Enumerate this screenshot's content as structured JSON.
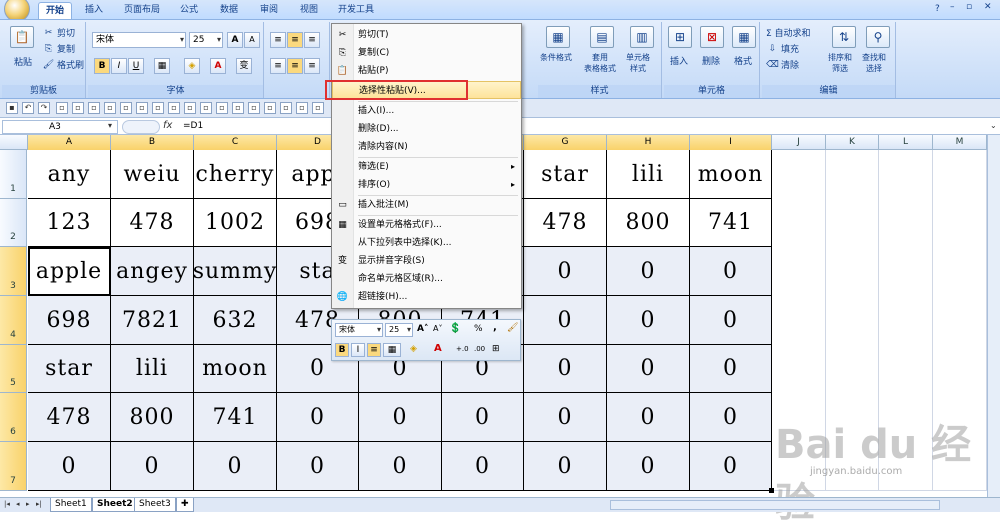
{
  "tabs": [
    "开始",
    "插入",
    "页面布局",
    "公式",
    "数据",
    "审阅",
    "视图",
    "开发工具"
  ],
  "ribbon": {
    "clipboard": {
      "paste": "粘贴",
      "cut": "剪切",
      "copy": "复制",
      "format_painter": "格式刷",
      "label": "剪贴板"
    },
    "font": {
      "name": "宋体",
      "size": "25",
      "label": "字体",
      "bold": "B",
      "italic": "I",
      "underline": "U",
      "grow": "A",
      "shrink": "A",
      "phonetic": "变"
    },
    "styles": {
      "conditional": "条件格式",
      "table": "套用\n表格格式",
      "cell": "单元格\n样式",
      "label": "样式"
    },
    "cells": {
      "insert": "插入",
      "delete": "删除",
      "format": "格式",
      "label": "单元格"
    },
    "editing": {
      "autosum": "Σ 自动求和",
      "fill": "填充",
      "clear": "清除",
      "sort": "排序和\n筛选",
      "find": "查找和\n选择",
      "label": "编辑"
    }
  },
  "formula_bar": {
    "name_box": "A3",
    "fx": "fx",
    "formula": "=D1"
  },
  "columns": [
    "A",
    "B",
    "C",
    "D",
    "E",
    "F",
    "G",
    "H",
    "I",
    "J",
    "K",
    "L",
    "M"
  ],
  "rows": [
    "1",
    "2",
    "3",
    "4",
    "5",
    "6",
    "7"
  ],
  "cells": [
    [
      "any",
      "weiu",
      "cherry",
      "appl",
      "",
      "",
      "star",
      "lili",
      "moon"
    ],
    [
      "123",
      "478",
      "1002",
      "698",
      "",
      "",
      "478",
      "800",
      "741"
    ],
    [
      "apple",
      "angey",
      "summy",
      "sta",
      "",
      "",
      "0",
      "0",
      "0"
    ],
    [
      "698",
      "7821",
      "632",
      "478",
      "800",
      "741",
      "0",
      "0",
      "0"
    ],
    [
      "star",
      "lili",
      "moon",
      "0",
      "0",
      "0",
      "0",
      "0",
      "0"
    ],
    [
      "478",
      "800",
      "741",
      "0",
      "0",
      "0",
      "0",
      "0",
      "0"
    ],
    [
      "0",
      "0",
      "0",
      "0",
      "0",
      "0",
      "0",
      "0",
      "0"
    ]
  ],
  "context_menu": {
    "items": [
      {
        "label": "剪切(T)",
        "icon": "✂"
      },
      {
        "label": "复制(C)",
        "icon": "⎘"
      },
      {
        "label": "粘贴(P)",
        "icon": "📋"
      },
      {
        "label": "选择性粘贴(V)...",
        "icon": ""
      },
      {
        "label": "插入(I)...",
        "icon": ""
      },
      {
        "label": "删除(D)...",
        "icon": ""
      },
      {
        "label": "清除内容(N)",
        "icon": ""
      },
      {
        "label": "筛选(E)",
        "icon": "",
        "arrow": "▸"
      },
      {
        "label": "排序(O)",
        "icon": "",
        "arrow": "▸"
      },
      {
        "label": "插入批注(M)",
        "icon": "▭"
      },
      {
        "label": "设置单元格格式(F)...",
        "icon": "▦"
      },
      {
        "label": "从下拉列表中选择(K)...",
        "icon": ""
      },
      {
        "label": "显示拼音字段(S)",
        "icon": "变"
      },
      {
        "label": "命名单元格区域(R)...",
        "icon": ""
      },
      {
        "label": "超链接(H)...",
        "icon": "🌐"
      }
    ]
  },
  "mini_toolbar": {
    "font": "宋体",
    "size": "25",
    "percent": "%",
    "comma": ","
  },
  "sheets": [
    "Sheet1",
    "Sheet2",
    "Sheet3"
  ],
  "watermark": {
    "brand": "Bai du 经验",
    "url": "jingyan.baidu.com"
  }
}
